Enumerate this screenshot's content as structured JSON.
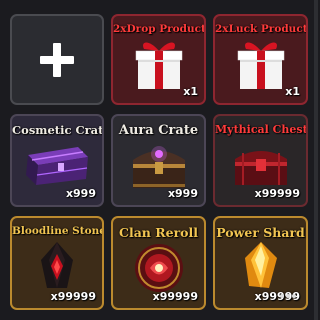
{
  "slots": [
    {
      "id": "add",
      "type": "empty",
      "icon": "plus-icon"
    },
    {
      "id": "drop",
      "title": "2xDrop Product",
      "count": "x1",
      "icon": "gift-box-icon"
    },
    {
      "id": "luck",
      "title": "2xLuck Product",
      "count": "x1",
      "icon": "gift-box-icon"
    },
    {
      "id": "cosmetic",
      "title": "Cosmetic Crate",
      "count": "x999",
      "icon": "purple-crate-icon"
    },
    {
      "id": "aura",
      "title": "Aura Crate",
      "count": "x999",
      "icon": "aura-chest-icon"
    },
    {
      "id": "mythical",
      "title": "Mythical Chest",
      "count": "x99999",
      "icon": "red-chest-icon"
    },
    {
      "id": "bloodline",
      "title": "Bloodline Stone",
      "count": "x99999",
      "icon": "dark-crystal-icon"
    },
    {
      "id": "clan",
      "title": "Clan Reroll",
      "count": "x99999",
      "icon": "red-orb-icon"
    },
    {
      "id": "power",
      "title": "Power Shard",
      "count": "x99999",
      "icon": "gold-shard-icon"
    }
  ],
  "colors": {
    "red_title": "#ff3b3b",
    "gold_title": "#f1c552",
    "white_title": "#f0ece4"
  }
}
